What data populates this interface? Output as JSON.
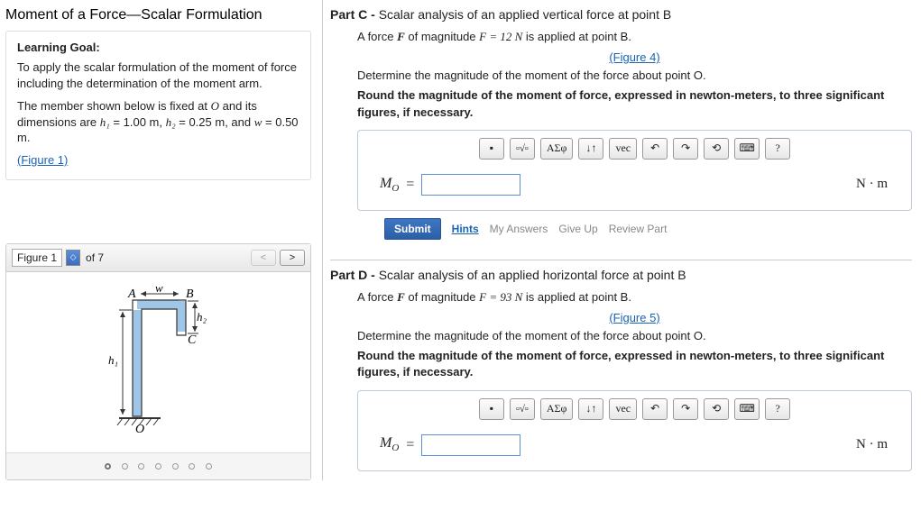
{
  "topic_title": "Moment of a Force—Scalar Formulation",
  "learning_goal": {
    "heading": "Learning Goal:",
    "p1": "To apply the scalar formulation of the moment of force including the determination of the moment arm.",
    "p2_pre": "The member shown below is fixed at ",
    "p2_O": "O",
    "p2_mid1": " and its dimensions are ",
    "h1_sym": "h₁",
    "h1_val": " = 1.00 m",
    "sep": ", ",
    "h2_sym": "h₂",
    "h2_val": " = 0.25 m",
    "and": ", and ",
    "w_sym": "w",
    "w_val": " = 0.50 m",
    "dot": ".",
    "fig1_link": "(Figure 1)"
  },
  "figure_nav": {
    "label": "Figure 1",
    "of": "of 7"
  },
  "fig_labels": {
    "A": "A",
    "B": "B",
    "C": "C",
    "O": "O",
    "w": "w",
    "h1": "h₁",
    "h2": "h₂"
  },
  "partC": {
    "title_prefix": "Part C - ",
    "title_rest": "Scalar analysis of an applied vertical force at point B",
    "line1_pre": "A force ",
    "F_bold": "F",
    "line1_mid": " of magnitude ",
    "F_eq": "F = 12 N",
    "line1_post": " is applied at point B.",
    "fig_link": "(Figure 4)",
    "line2": "Determine the magnitude of the moment of the force about point O.",
    "line3": "Round the magnitude of the moment of force, expressed in newton-meters, to three significant figures, if necessary.",
    "mo_label": "M",
    "mo_sub": "O",
    "eq": " = ",
    "unit": "N · m"
  },
  "partD": {
    "title_prefix": "Part D - ",
    "title_rest": "Scalar analysis of an applied horizontal force at point B",
    "line1_pre": "A force ",
    "F_bold": "F",
    "line1_mid": " of magnitude ",
    "F_eq": "F = 93 N",
    "line1_post": " is applied at point B.",
    "fig_link": "(Figure 5)",
    "line2": "Determine the magnitude of the moment of the force about point O.",
    "line3": "Round the magnitude of the moment of force, expressed in newton-meters, to three significant figures, if necessary.",
    "mo_label": "M",
    "mo_sub": "O",
    "eq": " = ",
    "unit": "N · m"
  },
  "toolbar": {
    "greek": "ΑΣφ",
    "vec": "vec",
    "help": "?"
  },
  "actions": {
    "submit": "Submit",
    "hints": "Hints",
    "my_answers": "My Answers",
    "give_up": "Give Up",
    "review": "Review Part"
  }
}
